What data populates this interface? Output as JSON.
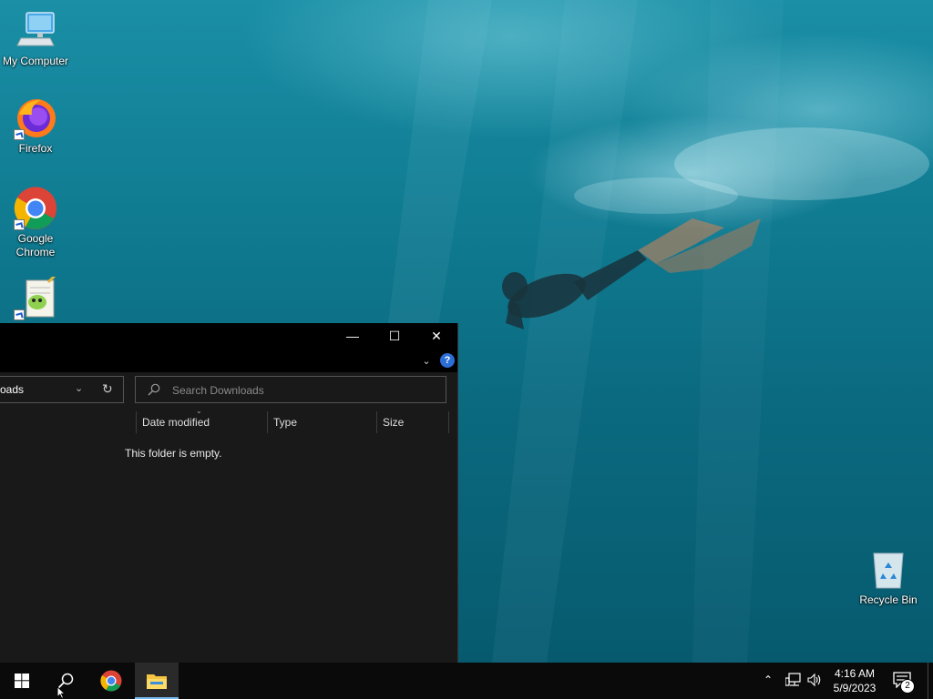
{
  "desktop": {
    "icons": [
      {
        "label": "My Computer",
        "icon": "computer-icon"
      },
      {
        "label": "Firefox",
        "icon": "firefox-icon"
      },
      {
        "label": "Google Chrome",
        "icon": "chrome-icon"
      },
      {
        "label": "",
        "icon": "notepad-plus-plus-icon"
      },
      {
        "label": "Recycle Bin",
        "icon": "recycle-bin-icon"
      }
    ]
  },
  "explorer": {
    "address_text": "oads",
    "search_placeholder": "Search Downloads",
    "columns": [
      "Date modified",
      "Type",
      "Size"
    ],
    "empty_message": "This folder is empty.",
    "window_controls": {
      "minimize": "—",
      "maximize": "☐",
      "close": "✕"
    },
    "help_label": "?"
  },
  "taskbar": {
    "pinned": [
      "windows-start-icon",
      "search-icon",
      "chrome-icon",
      "file-explorer-icon"
    ],
    "clock_time": "4:16 AM",
    "clock_date": "5/9/2023",
    "notification_count": "2"
  },
  "colors": {
    "taskbar_bg": "#0a0a0a",
    "explorer_bg": "#191919",
    "accent": "#76b9ed"
  }
}
